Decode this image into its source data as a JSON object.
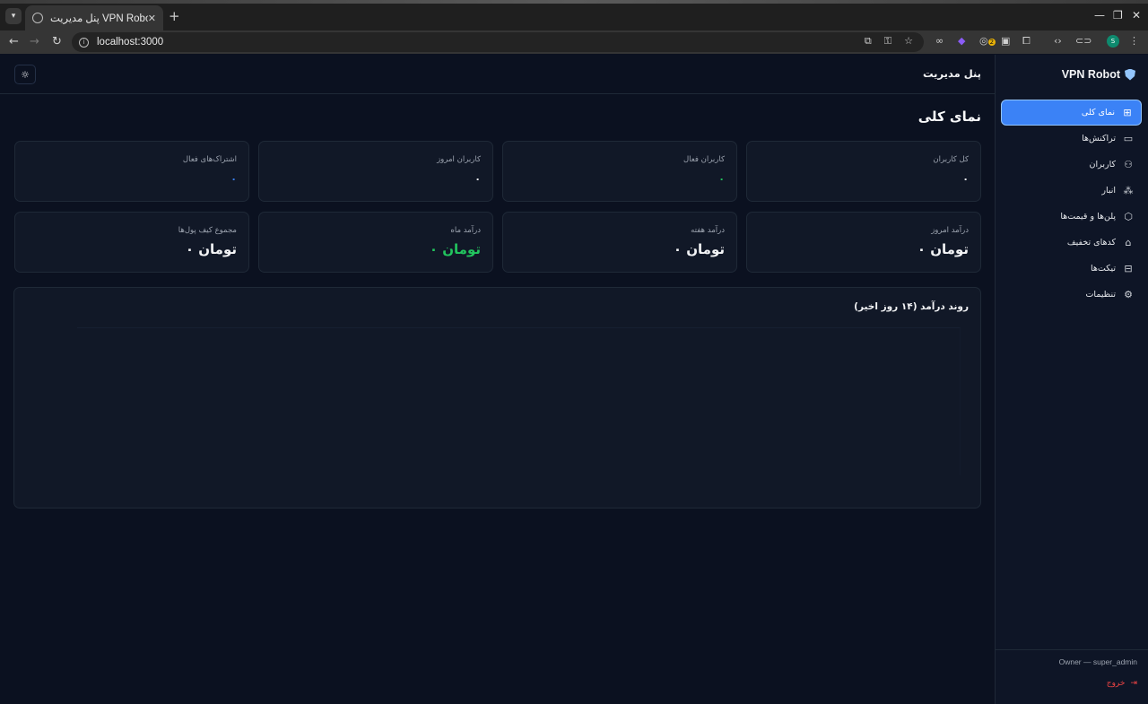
{
  "browser": {
    "tab_title": "پنل مدیریت VPN Robot",
    "url": "localhost:3000",
    "extension_badge": "2",
    "profile_initial": "S"
  },
  "sidebar": {
    "brand": "VPN Robot",
    "items": [
      {
        "label": "نمای کلی",
        "icon": "grid-icon",
        "active": true
      },
      {
        "label": "تراکنش‌ها",
        "icon": "card-icon",
        "active": false
      },
      {
        "label": "کاربران",
        "icon": "users-icon",
        "active": false
      },
      {
        "label": "انبار",
        "icon": "boxes-icon",
        "active": false
      },
      {
        "label": "پلن‌ها و قیمت‌ها",
        "icon": "package-icon",
        "active": false
      },
      {
        "label": "کدهای تخفیف",
        "icon": "tag-icon",
        "active": false
      },
      {
        "label": "تیکت‌ها",
        "icon": "ticket-icon",
        "active": false
      },
      {
        "label": "تنظیمات",
        "icon": "gear-icon",
        "active": false
      }
    ],
    "owner": "Owner — super_admin",
    "logout": "خروج"
  },
  "header": {
    "title": "پنل مدیریت"
  },
  "page": {
    "title": "نمای کلی"
  },
  "stats_row1": [
    {
      "label": "کل کاربران",
      "value": "۰"
    },
    {
      "label": "کاربران فعال",
      "value": "۰",
      "color": "#22c55e"
    },
    {
      "label": "کاربران امروز",
      "value": "۰"
    },
    {
      "label": "اشتراک‌های فعال",
      "value": "۰",
      "color": "#3b82f6"
    }
  ],
  "stats_row2": [
    {
      "label": "درآمد امروز",
      "value": "۰ تومان"
    },
    {
      "label": "درآمد هفته",
      "value": "۰ تومان"
    },
    {
      "label": "درآمد ماه",
      "value": "۰ تومان",
      "color": "#22c55e"
    },
    {
      "label": "مجموع کیف پول‌ها",
      "value": "۰ تومان"
    }
  ],
  "chart": {
    "title": "روند درآمد (۱۴ روز اخیر)"
  }
}
